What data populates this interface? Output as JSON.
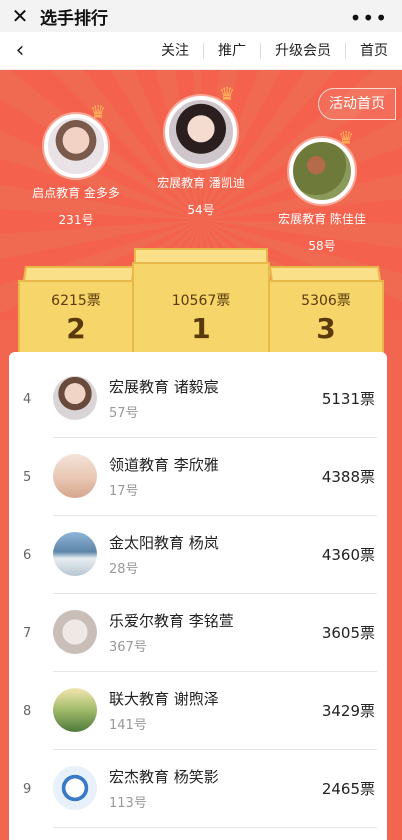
{
  "titlebar": {
    "close_icon": "close-icon",
    "title": "选手排行",
    "more_icon": "more-icon"
  },
  "navbar": {
    "back_icon": "chevron-left-icon",
    "links": [
      "关注",
      "推广",
      "升级会员",
      "首页"
    ]
  },
  "hero": {
    "activity_button": "活动首页"
  },
  "top3": [
    {
      "rank": "2",
      "name": "启点教育 金多多",
      "number": "231号",
      "votes": "6215票"
    },
    {
      "rank": "1",
      "name": "宏展教育 潘凯迪",
      "number": "54号",
      "votes": "10567票"
    },
    {
      "rank": "3",
      "name": "宏展教育 陈佳佳",
      "number": "58号",
      "votes": "5306票"
    }
  ],
  "ranking": [
    {
      "index": "4",
      "name": "宏展教育 诸毅宸",
      "number": "57号",
      "votes": "5131票"
    },
    {
      "index": "5",
      "name": "领道教育 李欣雅",
      "number": "17号",
      "votes": "4388票"
    },
    {
      "index": "6",
      "name": "金太阳教育 杨岚",
      "number": "28号",
      "votes": "4360票"
    },
    {
      "index": "7",
      "name": "乐爱尔教育 李铭萱",
      "number": "367号",
      "votes": "3605票"
    },
    {
      "index": "8",
      "name": "联大教育 谢煦泽",
      "number": "141号",
      "votes": "3429票"
    },
    {
      "index": "9",
      "name": "宏杰教育 杨笑影",
      "number": "113号",
      "votes": "2465票"
    }
  ],
  "colors": {
    "hero_red": "#f4614c",
    "podium_gold": "#f6d66a",
    "crown": "#ffb35a"
  }
}
